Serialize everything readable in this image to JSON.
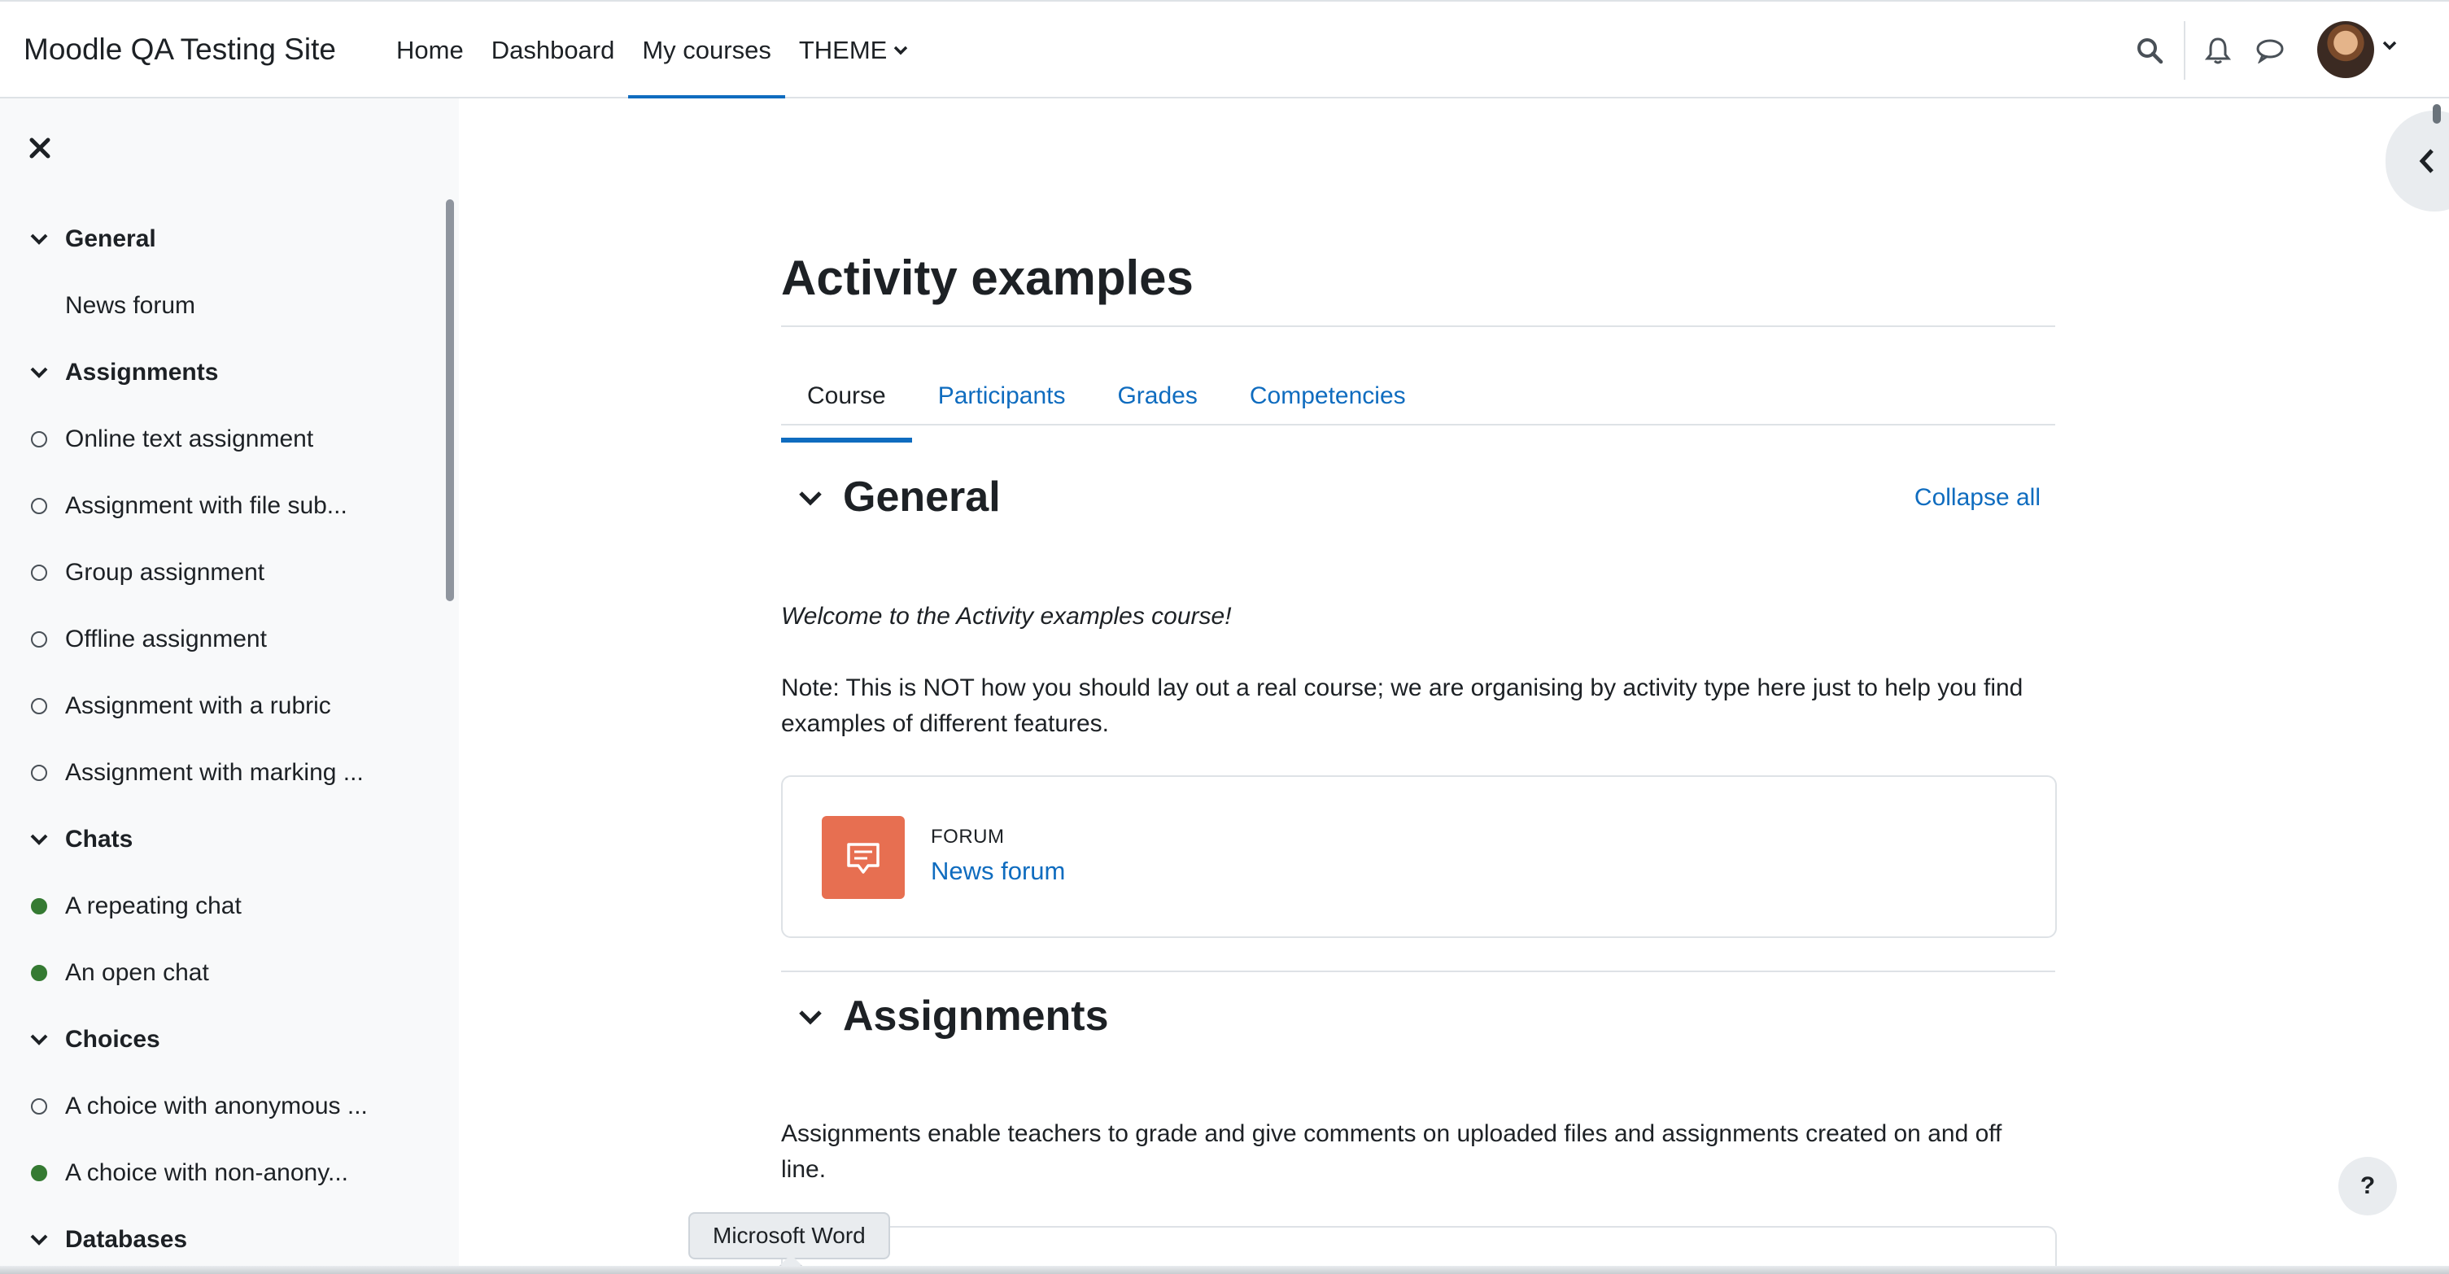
{
  "site": {
    "name": "Moodle QA Testing Site"
  },
  "nav": {
    "items": [
      {
        "label": "Home",
        "active": false
      },
      {
        "label": "Dashboard",
        "active": false
      },
      {
        "label": "My courses",
        "active": true
      },
      {
        "label": "THEME",
        "active": false,
        "dropdown": true
      }
    ],
    "icons": [
      "search-icon",
      "bell-icon",
      "chat-bubble-icon",
      "avatar",
      "chevron-down-icon"
    ]
  },
  "course_index": {
    "close_icon": "close-icon",
    "sections": [
      {
        "title": "General",
        "items": [
          {
            "label": "News forum",
            "status": "none"
          }
        ]
      },
      {
        "title": "Assignments",
        "items": [
          {
            "label": "Online text assignment",
            "status": "open"
          },
          {
            "label": "Assignment with file sub...",
            "status": "open"
          },
          {
            "label": "Group assignment",
            "status": "open"
          },
          {
            "label": "Offline assignment",
            "status": "open"
          },
          {
            "label": "Assignment with a rubric",
            "status": "open"
          },
          {
            "label": "Assignment with marking ...",
            "status": "open"
          }
        ]
      },
      {
        "title": "Chats",
        "items": [
          {
            "label": "A repeating chat",
            "status": "done"
          },
          {
            "label": "An open chat",
            "status": "done"
          }
        ]
      },
      {
        "title": "Choices",
        "items": [
          {
            "label": "A choice with anonymous ...",
            "status": "open"
          },
          {
            "label": "A choice with non-anony...",
            "status": "done"
          }
        ]
      },
      {
        "title": "Databases",
        "items": []
      }
    ]
  },
  "main": {
    "title": "Activity examples",
    "tabs": [
      {
        "label": "Course",
        "active": true
      },
      {
        "label": "Participants",
        "active": false
      },
      {
        "label": "Grades",
        "active": false
      },
      {
        "label": "Competencies",
        "active": false
      }
    ],
    "collapse_all": "Collapse all",
    "sections": [
      {
        "title": "General",
        "welcome": "Welcome to the Activity examples course!",
        "note": "Note: This is NOT how you should lay out a real course; we are organising by activity type here just to help you find examples of different features.",
        "activity": {
          "type": "FORUM",
          "name": "News forum",
          "icon": "forum-icon",
          "color": "#e76f51"
        }
      },
      {
        "title": "Assignments",
        "description": "Assignments enable teachers to grade and give comments on uploaded files and assignments created on and off line."
      }
    ]
  },
  "tooltip": "Microsoft Word",
  "help_label": "?",
  "colors": {
    "link": "#0f6cbf",
    "completed": "#357a32",
    "forum_icon": "#e76f51",
    "assign_icon": "#e7344b"
  }
}
